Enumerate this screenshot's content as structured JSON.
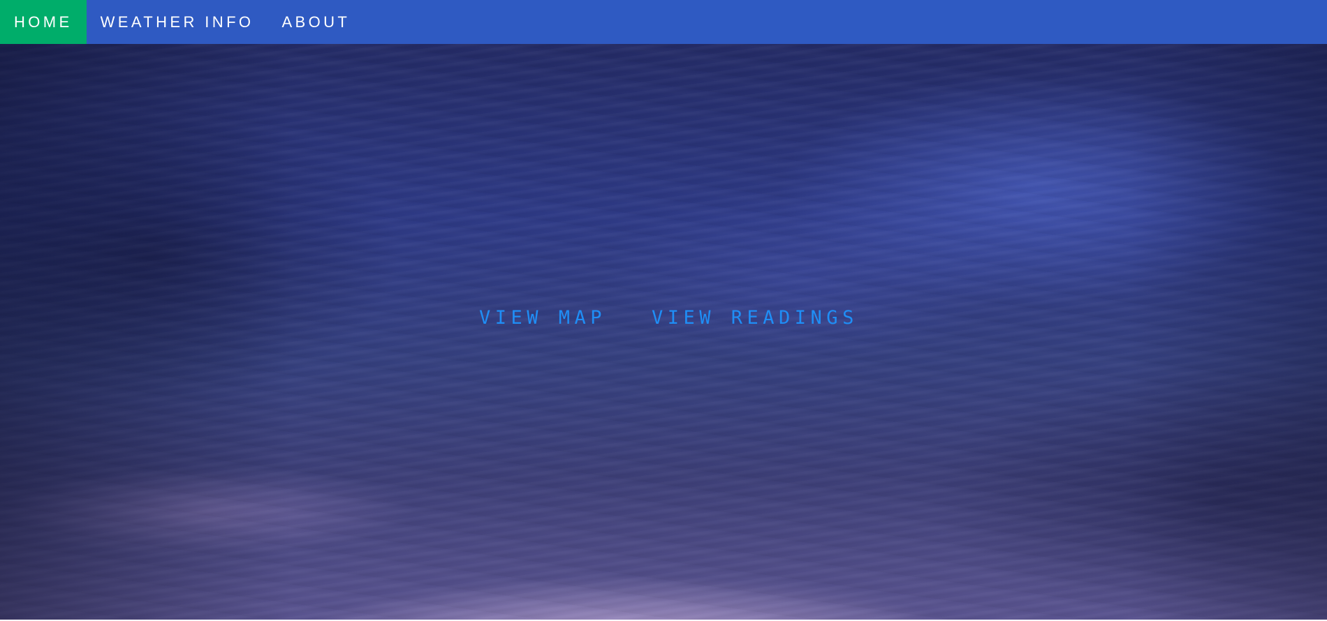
{
  "navbar": {
    "items": [
      {
        "label": "HOME",
        "active": true
      },
      {
        "label": "WEATHER INFO",
        "active": false
      },
      {
        "label": "ABOUT",
        "active": false
      }
    ]
  },
  "hero": {
    "links": [
      {
        "label": "VIEW MAP"
      },
      {
        "label": "VIEW READINGS"
      }
    ]
  },
  "colors": {
    "nav_background": "#2f5ac2",
    "nav_active": "#00ad6a",
    "nav_text": "#ffffff",
    "link_text": "#1f8ef6",
    "hero_sky": "#2e3a86"
  }
}
